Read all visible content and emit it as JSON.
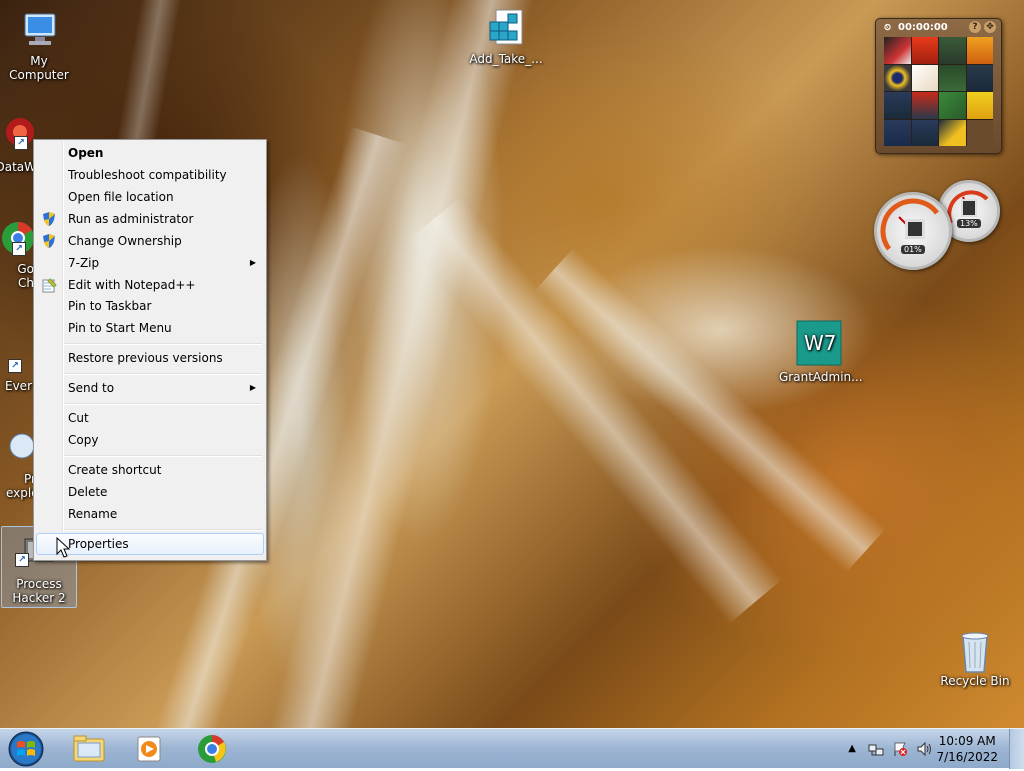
{
  "desktop": {
    "icons": {
      "my_computer": "My Computer",
      "dataw": "DataW",
      "google_chrome": "Go Ch",
      "everything": "Ever",
      "process_explorer": "Pr explo",
      "process_hacker": "Process Hacker 2",
      "add_take": "Add_Take_...",
      "grant_admin": "GrantAdmin...",
      "recycle_bin": "Recycle Bin"
    }
  },
  "context_menu": {
    "items": [
      {
        "label": "Open",
        "bold": true
      },
      {
        "label": "Troubleshoot compatibility"
      },
      {
        "label": "Open file location"
      },
      {
        "label": "Run as administrator",
        "icon": "uac-shield-icon"
      },
      {
        "label": "Change Ownership",
        "icon": "uac-shield-icon"
      },
      {
        "label": "7-Zip",
        "submenu": true
      },
      {
        "label": "Edit with Notepad++",
        "icon": "notepad-plus-plus-icon"
      },
      {
        "label": "Pin to Taskbar"
      },
      {
        "label": "Pin to Start Menu"
      },
      {
        "label": "Restore previous versions"
      },
      {
        "label": "Send to",
        "submenu": true
      },
      {
        "label": "Cut"
      },
      {
        "label": "Copy"
      },
      {
        "label": "Create shortcut"
      },
      {
        "label": "Delete"
      },
      {
        "label": "Rename"
      },
      {
        "label": "Properties",
        "highlighted": true
      }
    ]
  },
  "gadgets": {
    "puzzle_timer": "00:00:00",
    "cpu_meter": {
      "cpu_label": "01%",
      "memory_label": "13%"
    }
  },
  "taskbar": {
    "start": "start-orb-icon",
    "pinned": [
      "explorer-folder-icon",
      "media-player-icon",
      "chrome-icon"
    ],
    "tray": [
      "show-hidden-icons-chevron",
      "network-icon",
      "action-center-flag-icon",
      "volume-icon"
    ],
    "clock": {
      "time": "10:09 AM",
      "date": "7/16/2022"
    }
  },
  "colors": {
    "menu_bg": "#f0f0f0",
    "menu_hover": "#e8f1fb",
    "taskbar": "#9db5d3",
    "selection_blue": "#3399ff"
  }
}
